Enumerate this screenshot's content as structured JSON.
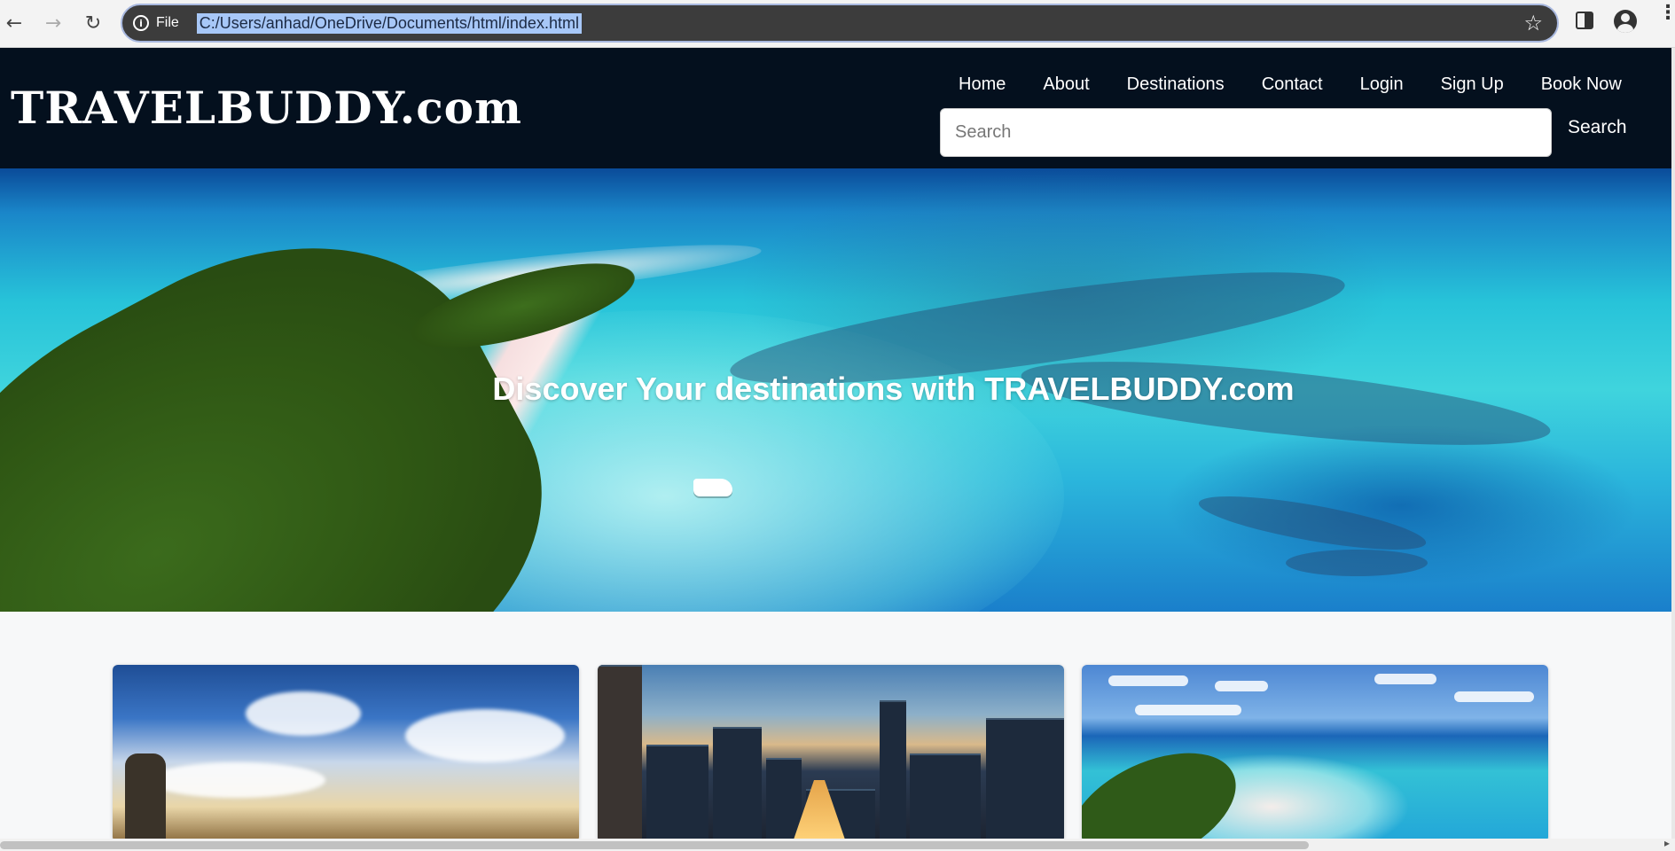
{
  "browser": {
    "back_icon": "←",
    "forward_icon": "→",
    "reload_icon": "↻",
    "info_icon": "i",
    "scheme_label": "File",
    "url": "C:/Users/anhad/OneDrive/Documents/html/index.html",
    "star_icon": "☆",
    "menu_icon": "⋮",
    "accent_color": "#a8b8df",
    "icons": [
      "arrow-left-icon",
      "arrow-right-icon",
      "reload-icon",
      "info-icon",
      "star-icon",
      "side-panel-icon",
      "profile-icon",
      "kebab-menu-icon"
    ]
  },
  "site": {
    "logo": "TRAVELBUDDY.com",
    "header_color": "#04101e",
    "nav": [
      {
        "label": "Home"
      },
      {
        "label": "About"
      },
      {
        "label": "Destinations"
      },
      {
        "label": "Contact"
      },
      {
        "label": "Login"
      },
      {
        "label": "Sign Up"
      },
      {
        "label": "Book Now"
      }
    ],
    "search": {
      "placeholder": "Search",
      "button_label": "Search"
    }
  },
  "hero": {
    "title": "Discover Your destinations with TRAVELBUDDY.com"
  },
  "cards": [
    {
      "image": "singapore-skyline-clouds-image"
    },
    {
      "image": "city-skyline-sunset-image"
    },
    {
      "image": "tropical-island-lagoon-image"
    }
  ],
  "scrollbar": {
    "right_arrow": "▸"
  }
}
